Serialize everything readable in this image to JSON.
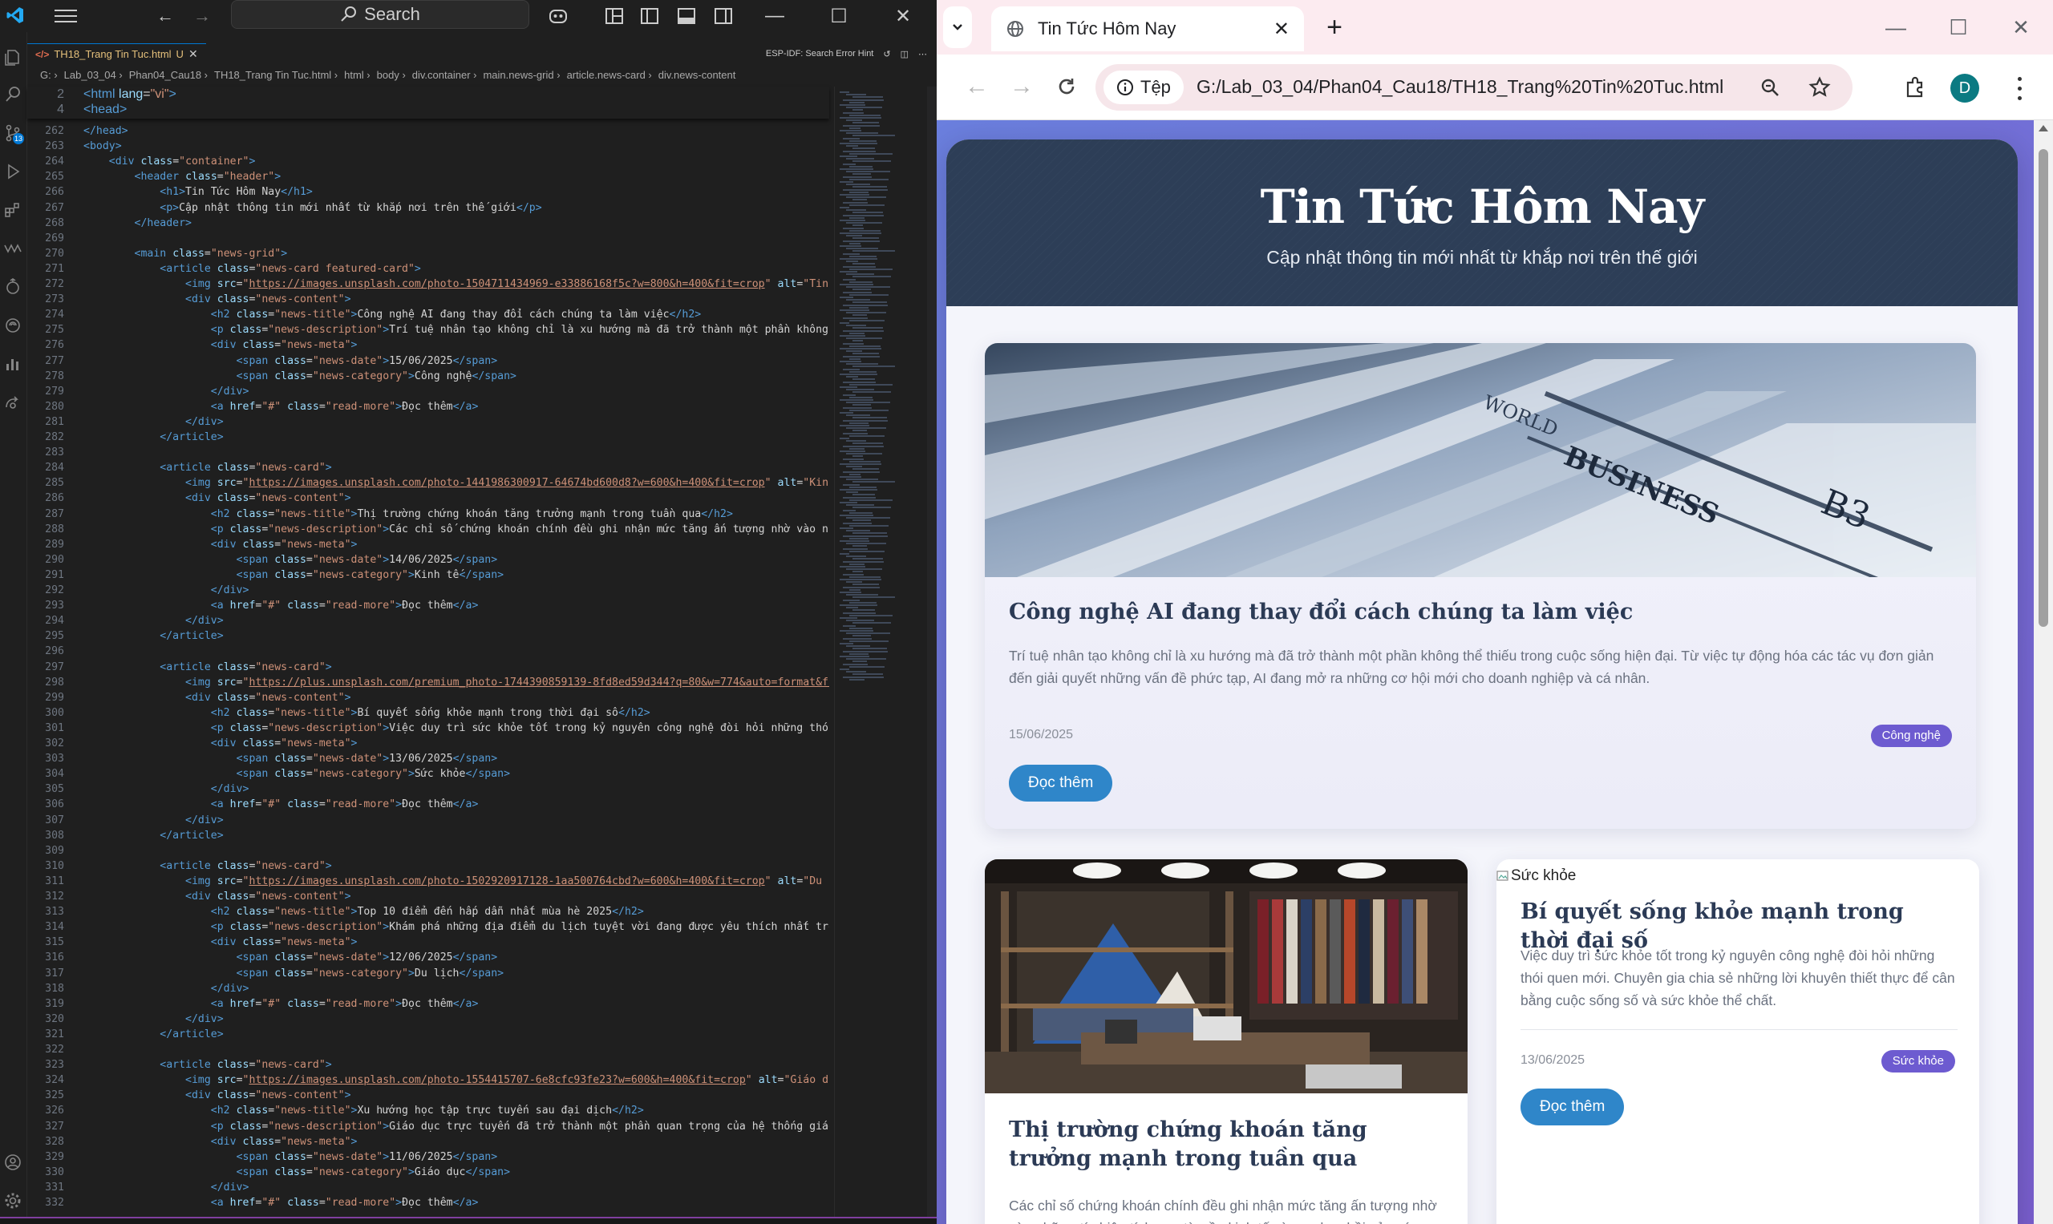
{
  "vscode": {
    "search_label": "Search",
    "tab_label": "TH18_Trang Tin Tuc.html",
    "tab_status": "U",
    "esp_hint": "ESP-IDF: Search Error Hint",
    "breadcrumb": [
      "G:",
      "Lab_03_04",
      "Phan04_Cau18",
      "TH18_Trang Tin Tuc.html",
      "html",
      "body",
      "div.container",
      "main.news-grid",
      "article.news-card",
      "div.news-content"
    ],
    "sticky": [
      {
        "n": "2",
        "h": "<span class='tg'>&lt;html</span> <span class='at'>lang</span>=<span class='sv'>\"vi\"</span><span class='tg'>&gt;</span>"
      },
      {
        "n": "4",
        "h": "<span class='tg'>&lt;head&gt;</span>"
      }
    ],
    "lines": [
      {
        "n": "262",
        "h": "<span class='tg'>&lt;/head&gt;</span>"
      },
      {
        "n": "263",
        "h": "<span class='tg'>&lt;body&gt;</span>"
      },
      {
        "n": "264",
        "h": "    <span class='tg'>&lt;div</span> <span class='at'>class</span>=<span class='sv'>\"container\"</span><span class='tg'>&gt;</span>"
      },
      {
        "n": "265",
        "h": "        <span class='tg'>&lt;header</span> <span class='at'>class</span>=<span class='sv'>\"header\"</span><span class='tg'>&gt;</span>"
      },
      {
        "n": "266",
        "h": "            <span class='tg'>&lt;h1&gt;</span>Tin Tức Hôm Nay<span class='tg'>&lt;/h1&gt;</span>"
      },
      {
        "n": "267",
        "h": "            <span class='tg'>&lt;p&gt;</span>Cập nhật thông tin mới nhất từ khắp nơi trên thế giới<span class='tg'>&lt;/p&gt;</span>"
      },
      {
        "n": "268",
        "h": "        <span class='tg'>&lt;/header&gt;</span>"
      },
      {
        "n": "269",
        "h": ""
      },
      {
        "n": "270",
        "h": "        <span class='tg'>&lt;main</span> <span class='at'>class</span>=<span class='sv'>\"news-grid\"</span><span class='tg'>&gt;</span>"
      },
      {
        "n": "271",
        "h": "            <span class='tg'>&lt;article</span> <span class='at'>class</span>=<span class='sv'>\"news-card featured-card\"</span><span class='tg'>&gt;</span>"
      },
      {
        "n": "272",
        "h": "                <span class='tg'>&lt;img</span> <span class='at'>src</span>=<span class='sv'>\"</span><span class='ul'>https://images.unsplash.com/photo-1504711434969-e33886168f5c?w=800&amp;h=400&amp;fit=crop</span><span class='sv'>\"</span> <span class='at'>alt</span>=<span class='sv'>\"Tin tức</span>"
      },
      {
        "n": "273",
        "h": "                <span class='tg'>&lt;div</span> <span class='at'>class</span>=<span class='sv'>\"news-content\"</span><span class='tg'>&gt;</span>"
      },
      {
        "n": "274",
        "h": "                    <span class='tg'>&lt;h2</span> <span class='at'>class</span>=<span class='sv'>\"news-title\"</span><span class='tg'>&gt;</span>Công nghệ AI đang thay đổi cách chúng ta làm việc<span class='tg'>&lt;/h2&gt;</span>"
      },
      {
        "n": "275",
        "h": "                    <span class='tg'>&lt;p</span> <span class='at'>class</span>=<span class='sv'>\"news-description\"</span><span class='tg'>&gt;</span>Trí tuệ nhân tạo không chỉ là xu hướng mà đã trở thành một phần không thể"
      },
      {
        "n": "276",
        "h": "                    <span class='tg'>&lt;div</span> <span class='at'>class</span>=<span class='sv'>\"news-meta\"</span><span class='tg'>&gt;</span>"
      },
      {
        "n": "277",
        "h": "                        <span class='tg'>&lt;span</span> <span class='at'>class</span>=<span class='sv'>\"news-date\"</span><span class='tg'>&gt;</span>15/06/2025<span class='tg'>&lt;/span&gt;</span>"
      },
      {
        "n": "278",
        "h": "                        <span class='tg'>&lt;span</span> <span class='at'>class</span>=<span class='sv'>\"news-category\"</span><span class='tg'>&gt;</span>Công nghệ<span class='tg'>&lt;/span&gt;</span>"
      },
      {
        "n": "279",
        "h": "                    <span class='tg'>&lt;/div&gt;</span>"
      },
      {
        "n": "280",
        "h": "                    <span class='tg'>&lt;a</span> <span class='at'>href</span>=<span class='sv'>\"#\"</span> <span class='at'>class</span>=<span class='sv'>\"read-more\"</span><span class='tg'>&gt;</span>Đọc thêm<span class='tg'>&lt;/a&gt;</span>"
      },
      {
        "n": "281",
        "h": "                <span class='tg'>&lt;/div&gt;</span>"
      },
      {
        "n": "282",
        "h": "            <span class='tg'>&lt;/article&gt;</span>"
      },
      {
        "n": "283",
        "h": ""
      },
      {
        "n": "284",
        "h": "            <span class='tg'>&lt;article</span> <span class='at'>class</span>=<span class='sv'>\"news-card\"</span><span class='tg'>&gt;</span>"
      },
      {
        "n": "285",
        "h": "                <span class='tg'>&lt;img</span> <span class='at'>src</span>=<span class='sv'>\"</span><span class='ul'>https://images.unsplash.com/photo-1441986300917-64674bd600d8?w=600&amp;h=400&amp;fit=crop</span><span class='sv'>\"</span> <span class='at'>alt</span>=<span class='sv'>\"Kinh tế</span>"
      },
      {
        "n": "286",
        "h": "                <span class='tg'>&lt;div</span> <span class='at'>class</span>=<span class='sv'>\"news-content\"</span><span class='tg'>&gt;</span>"
      },
      {
        "n": "287",
        "h": "                    <span class='tg'>&lt;h2</span> <span class='at'>class</span>=<span class='sv'>\"news-title\"</span><span class='tg'>&gt;</span>Thị trường chứng khoán tăng trưởng mạnh trong tuần qua<span class='tg'>&lt;/h2&gt;</span>"
      },
      {
        "n": "288",
        "h": "                    <span class='tg'>&lt;p</span> <span class='at'>class</span>=<span class='sv'>\"news-description\"</span><span class='tg'>&gt;</span>Các chỉ số chứng khoán chính đều ghi nhận mức tăng ấn tượng nhờ vào những"
      },
      {
        "n": "289",
        "h": "                    <span class='tg'>&lt;div</span> <span class='at'>class</span>=<span class='sv'>\"news-meta\"</span><span class='tg'>&gt;</span>"
      },
      {
        "n": "290",
        "h": "                        <span class='tg'>&lt;span</span> <span class='at'>class</span>=<span class='sv'>\"news-date\"</span><span class='tg'>&gt;</span>14/06/2025<span class='tg'>&lt;/span&gt;</span>"
      },
      {
        "n": "291",
        "h": "                        <span class='tg'>&lt;span</span> <span class='at'>class</span>=<span class='sv'>\"news-category\"</span><span class='tg'>&gt;</span>Kinh tế<span class='tg'>&lt;/span&gt;</span>"
      },
      {
        "n": "292",
        "h": "                    <span class='tg'>&lt;/div&gt;</span>"
      },
      {
        "n": "293",
        "h": "                    <span class='tg'>&lt;a</span> <span class='at'>href</span>=<span class='sv'>\"#\"</span> <span class='at'>class</span>=<span class='sv'>\"read-more\"</span><span class='tg'>&gt;</span>Đọc thêm<span class='tg'>&lt;/a&gt;</span>"
      },
      {
        "n": "294",
        "h": "                <span class='tg'>&lt;/div&gt;</span>"
      },
      {
        "n": "295",
        "h": "            <span class='tg'>&lt;/article&gt;</span>"
      },
      {
        "n": "296",
        "h": ""
      },
      {
        "n": "297",
        "h": "            <span class='tg'>&lt;article</span> <span class='at'>class</span>=<span class='sv'>\"news-card\"</span><span class='tg'>&gt;</span>"
      },
      {
        "n": "298",
        "h": "                <span class='tg'>&lt;img</span> <span class='at'>src</span>=<span class='sv'>\"</span><span class='ul'>https://plus.unsplash.com/premium_photo-1744390859139-8fd8ed59d344?q=80&amp;w=774&amp;auto=format&amp;fit=crop</span>"
      },
      {
        "n": "299",
        "h": "                <span class='tg'>&lt;div</span> <span class='at'>class</span>=<span class='sv'>\"news-content\"</span><span class='tg'>&gt;</span>"
      },
      {
        "n": "300",
        "h": "                    <span class='tg'>&lt;h2</span> <span class='at'>class</span>=<span class='sv'>\"news-title\"</span><span class='tg'>&gt;</span>Bí quyết sống khỏe mạnh trong thời đại số<span class='tg'>&lt;/h2&gt;</span>"
      },
      {
        "n": "301",
        "h": "                    <span class='tg'>&lt;p</span> <span class='at'>class</span>=<span class='sv'>\"news-description\"</span><span class='tg'>&gt;</span>Việc duy trì sức khỏe tốt trong kỷ nguyên công nghệ đòi hỏi những thói quen"
      },
      {
        "n": "302",
        "h": "                    <span class='tg'>&lt;div</span> <span class='at'>class</span>=<span class='sv'>\"news-meta\"</span><span class='tg'>&gt;</span>"
      },
      {
        "n": "303",
        "h": "                        <span class='tg'>&lt;span</span> <span class='at'>class</span>=<span class='sv'>\"news-date\"</span><span class='tg'>&gt;</span>13/06/2025<span class='tg'>&lt;/span&gt;</span>"
      },
      {
        "n": "304",
        "h": "                        <span class='tg'>&lt;span</span> <span class='at'>class</span>=<span class='sv'>\"news-category\"</span><span class='tg'>&gt;</span>Sức khỏe<span class='tg'>&lt;/span&gt;</span>"
      },
      {
        "n": "305",
        "h": "                    <span class='tg'>&lt;/div&gt;</span>"
      },
      {
        "n": "306",
        "h": "                    <span class='tg'>&lt;a</span> <span class='at'>href</span>=<span class='sv'>\"#\"</span> <span class='at'>class</span>=<span class='sv'>\"read-more\"</span><span class='tg'>&gt;</span>Đọc thêm<span class='tg'>&lt;/a&gt;</span>"
      },
      {
        "n": "307",
        "h": "                <span class='tg'>&lt;/div&gt;</span>"
      },
      {
        "n": "308",
        "h": "            <span class='tg'>&lt;/article&gt;</span>"
      },
      {
        "n": "309",
        "h": ""
      },
      {
        "n": "310",
        "h": "            <span class='tg'>&lt;article</span> <span class='at'>class</span>=<span class='sv'>\"news-card\"</span><span class='tg'>&gt;</span>"
      },
      {
        "n": "311",
        "h": "                <span class='tg'>&lt;img</span> <span class='at'>src</span>=<span class='sv'>\"</span><span class='ul'>https://images.unsplash.com/photo-1502920917128-1aa500764cbd?w=600&amp;h=400&amp;fit=crop</span><span class='sv'>\"</span> <span class='at'>alt</span>=<span class='sv'>\"Du lịch</span>"
      },
      {
        "n": "312",
        "h": "                <span class='tg'>&lt;div</span> <span class='at'>class</span>=<span class='sv'>\"news-content\"</span><span class='tg'>&gt;</span>"
      },
      {
        "n": "313",
        "h": "                    <span class='tg'>&lt;h2</span> <span class='at'>class</span>=<span class='sv'>\"news-title\"</span><span class='tg'>&gt;</span>Top 10 điểm đến hấp dẫn nhất mùa hè 2025<span class='tg'>&lt;/h2&gt;</span>"
      },
      {
        "n": "314",
        "h": "                    <span class='tg'>&lt;p</span> <span class='at'>class</span>=<span class='sv'>\"news-description\"</span><span class='tg'>&gt;</span>Khám phá những địa điểm du lịch tuyệt vời đang được yêu thích nhất trong"
      },
      {
        "n": "315",
        "h": "                    <span class='tg'>&lt;div</span> <span class='at'>class</span>=<span class='sv'>\"news-meta\"</span><span class='tg'>&gt;</span>"
      },
      {
        "n": "316",
        "h": "                        <span class='tg'>&lt;span</span> <span class='at'>class</span>=<span class='sv'>\"news-date\"</span><span class='tg'>&gt;</span>12/06/2025<span class='tg'>&lt;/span&gt;</span>"
      },
      {
        "n": "317",
        "h": "                        <span class='tg'>&lt;span</span> <span class='at'>class</span>=<span class='sv'>\"news-category\"</span><span class='tg'>&gt;</span>Du lịch<span class='tg'>&lt;/span&gt;</span>"
      },
      {
        "n": "318",
        "h": "                    <span class='tg'>&lt;/div&gt;</span>"
      },
      {
        "n": "319",
        "h": "                    <span class='tg'>&lt;a</span> <span class='at'>href</span>=<span class='sv'>\"#\"</span> <span class='at'>class</span>=<span class='sv'>\"read-more\"</span><span class='tg'>&gt;</span>Đọc thêm<span class='tg'>&lt;/a&gt;</span>"
      },
      {
        "n": "320",
        "h": "                <span class='tg'>&lt;/div&gt;</span>"
      },
      {
        "n": "321",
        "h": "            <span class='tg'>&lt;/article&gt;</span>"
      },
      {
        "n": "322",
        "h": ""
      },
      {
        "n": "323",
        "h": "            <span class='tg'>&lt;article</span> <span class='at'>class</span>=<span class='sv'>\"news-card\"</span><span class='tg'>&gt;</span>"
      },
      {
        "n": "324",
        "h": "                <span class='tg'>&lt;img</span> <span class='at'>src</span>=<span class='sv'>\"</span><span class='ul'>https://images.unsplash.com/photo-1554415707-6e8cfc93fe23?w=600&amp;h=400&amp;fit=crop</span><span class='sv'>\"</span> <span class='at'>alt</span>=<span class='sv'>\"Giáo dục</span>"
      },
      {
        "n": "325",
        "h": "                <span class='tg'>&lt;div</span> <span class='at'>class</span>=<span class='sv'>\"news-content\"</span><span class='tg'>&gt;</span>"
      },
      {
        "n": "326",
        "h": "                    <span class='tg'>&lt;h2</span> <span class='at'>class</span>=<span class='sv'>\"news-title\"</span><span class='tg'>&gt;</span>Xu hướng học tập trực tuyến sau đại dịch<span class='tg'>&lt;/h2&gt;</span>"
      },
      {
        "n": "327",
        "h": "                    <span class='tg'>&lt;p</span> <span class='at'>class</span>=<span class='sv'>\"news-description\"</span><span class='tg'>&gt;</span>Giáo dục trực tuyến đã trở thành một phần quan trọng của hệ thống giáo dục"
      },
      {
        "n": "328",
        "h": "                    <span class='tg'>&lt;div</span> <span class='at'>class</span>=<span class='sv'>\"news-meta\"</span><span class='tg'>&gt;</span>"
      },
      {
        "n": "329",
        "h": "                        <span class='tg'>&lt;span</span> <span class='at'>class</span>=<span class='sv'>\"news-date\"</span><span class='tg'>&gt;</span>11/06/2025<span class='tg'>&lt;/span&gt;</span>"
      },
      {
        "n": "330",
        "h": "                        <span class='tg'>&lt;span</span> <span class='at'>class</span>=<span class='sv'>\"news-category\"</span><span class='tg'>&gt;</span>Giáo dục<span class='tg'>&lt;/span&gt;</span>"
      },
      {
        "n": "331",
        "h": "                    <span class='tg'>&lt;/div&gt;</span>"
      },
      {
        "n": "332",
        "h": "                    <span class='tg'>&lt;a</span> <span class='at'>href</span>=<span class='sv'>\"#\"</span> <span class='at'>class</span>=<span class='sv'>\"read-more\"</span><span class='tg'>&gt;</span>Đọc thêm<span class='tg'>&lt;/a&gt;</span>"
      }
    ]
  },
  "chrome": {
    "tab_title": "Tin Tức Hôm Nay",
    "chip_label": "Tệp",
    "url": "G:/Lab_03_04/Phan04_Cau18/TH18_Trang%20Tin%20Tuc.html",
    "avatar_letter": "D"
  },
  "page": {
    "title": "Tin Tức Hôm Nay",
    "subtitle": "Cập nhật thông tin mới nhất từ khắp nơi trên thế giới",
    "featured": {
      "title": "Công nghệ AI đang thay đổi cách chúng ta làm việc",
      "description": "Trí tuệ nhân tạo không chỉ là xu hướng mà đã trở thành một phần không thể thiếu trong cuộc sống hiện đại. Từ việc tự động hóa các tác vụ đơn giản đến giải quyết những vấn đề phức tạp, AI đang mở ra những cơ hội mới cho doanh nghiệp và cá nhân.",
      "date": "15/06/2025",
      "category": "Công nghệ",
      "read_more": "Đọc thêm"
    },
    "card_finance": {
      "title": "Thị trường chứng khoán tăng trưởng mạnh trong tuần qua",
      "description": "Các chỉ số chứng khoán chính đều ghi nhận mức tăng ấn tượng nhờ vào những tín hiệu tích cực từ nền kinh tế và sự phục hồi của các"
    },
    "card_health": {
      "broken_alt": "Sức khỏe",
      "title": "Bí quyết sống khỏe mạnh trong thời đại số",
      "description": "Việc duy trì sức khỏe tốt trong kỷ nguyên công nghệ đòi hỏi những thói quen mới. Chuyên gia chia sẻ những lời khuyên thiết thực để cân bằng cuộc sống số và sức khỏe thể chất.",
      "date": "13/06/2025",
      "category": "Sức khỏe",
      "read_more": "Đọc thêm"
    }
  }
}
